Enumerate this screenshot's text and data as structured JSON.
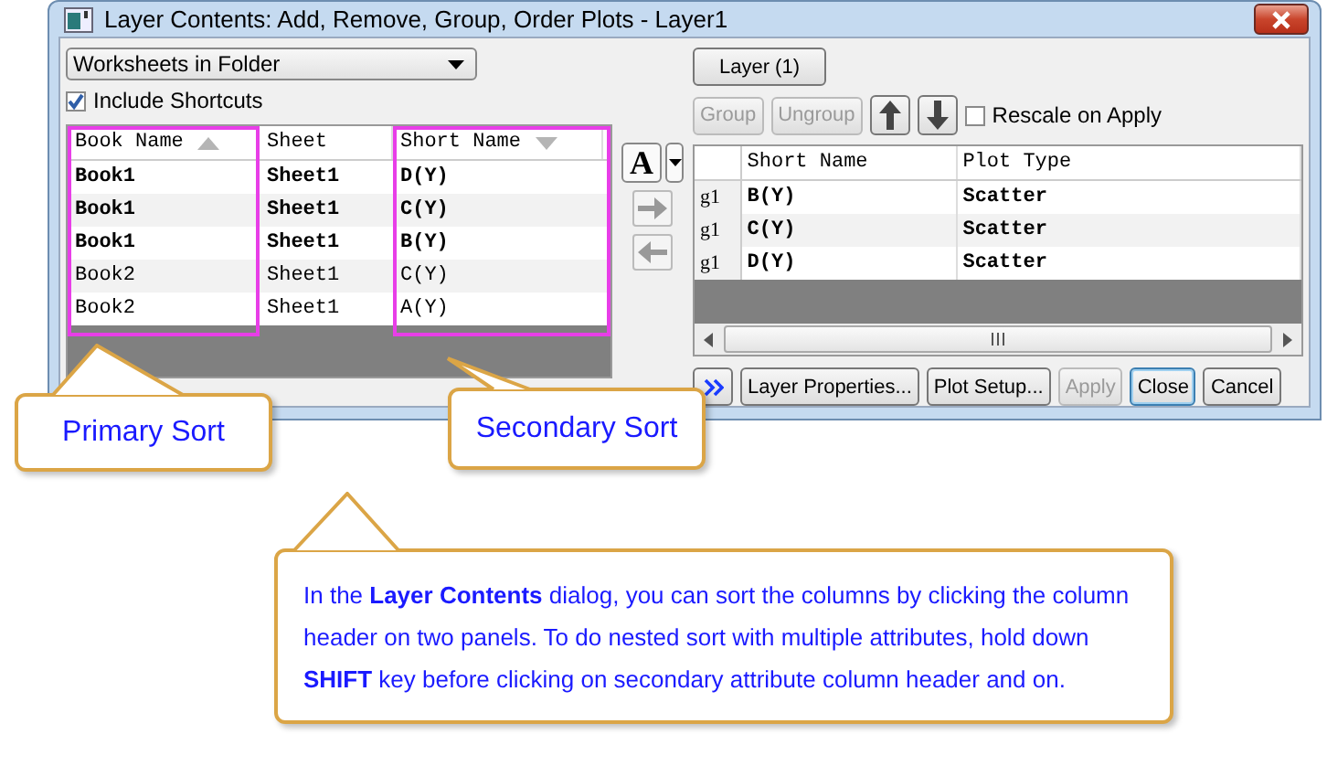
{
  "window": {
    "title": "Layer Contents: Add, Remove, Group, Order Plots - Layer1"
  },
  "source_dropdown": {
    "value": "Worksheets in Folder"
  },
  "include_shortcuts": {
    "label": "Include Shortcuts",
    "checked": true
  },
  "left_table": {
    "columns": [
      {
        "label": "Book Name",
        "sorted": true,
        "descending": false,
        "highlighted": true
      },
      {
        "label": "Sheet",
        "sorted": false,
        "highlighted": false
      },
      {
        "label": "Short Name",
        "sorted": true,
        "descending": true,
        "highlighted": true
      }
    ],
    "rows": [
      {
        "cells": [
          "Book1",
          "Sheet1",
          "D(Y)"
        ],
        "bold": true
      },
      {
        "cells": [
          "Book1",
          "Sheet1",
          "C(Y)"
        ],
        "bold": true
      },
      {
        "cells": [
          "Book1",
          "Sheet1",
          "B(Y)"
        ],
        "bold": true
      },
      {
        "cells": [
          "Book2",
          "Sheet1",
          "C(Y)"
        ],
        "bold": false
      },
      {
        "cells": [
          "Book2",
          "Sheet1",
          "A(Y)"
        ],
        "bold": false
      }
    ]
  },
  "font_button": {
    "label": "A"
  },
  "layer_button": {
    "label": "Layer (1)"
  },
  "group_buttons": [
    {
      "label": "Group",
      "disabled": true
    },
    {
      "label": "Ungroup",
      "disabled": true
    }
  ],
  "rescale_on_apply": {
    "label": "Rescale on Apply",
    "checked": false
  },
  "right_table": {
    "columns": [
      "Short Name",
      "Plot Type"
    ],
    "rows": [
      {
        "group": "g1",
        "cells": [
          "B(Y)",
          "Scatter"
        ]
      },
      {
        "group": "g1",
        "cells": [
          "C(Y)",
          "Scatter"
        ]
      },
      {
        "group": "g1",
        "cells": [
          "D(Y)",
          "Scatter"
        ]
      }
    ]
  },
  "bottom_buttons": [
    {
      "label": "Layer Properties...",
      "disabled": false,
      "focused": false
    },
    {
      "label": "Plot Setup...",
      "disabled": false,
      "focused": false
    },
    {
      "label": "Apply",
      "disabled": true,
      "focused": false
    },
    {
      "label": "Close",
      "disabled": false,
      "focused": true
    },
    {
      "label": "Cancel",
      "disabled": false,
      "focused": false
    }
  ],
  "callouts": [
    {
      "kind": "primary",
      "text": "Primary Sort"
    },
    {
      "kind": "secondary",
      "text": "Secondary Sort"
    },
    {
      "kind": "note",
      "text": "In the **Layer Contents** dialog, you can sort the columns by clicking the column header on two panels. To do nested sort with multiple attributes, hold down **SHIFT** key before clicking on secondary attribute column header and on."
    }
  ]
}
